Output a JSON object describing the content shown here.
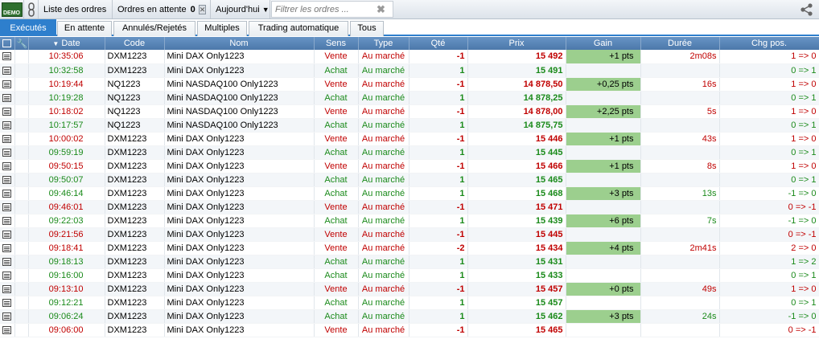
{
  "toolbar": {
    "logo_text": "DEMO",
    "list_label": "Liste des ordres",
    "pending_label": "Ordres en attente",
    "pending_count": "0",
    "today_label": "Aujourd'hui",
    "filter_placeholder": "Filtrer les ordres ..."
  },
  "tabs": [
    {
      "label": "Exécutés"
    },
    {
      "label": "En attente"
    },
    {
      "label": "Annulés/Rejetés"
    },
    {
      "label": "Multiples"
    },
    {
      "label": "Trading automatique"
    },
    {
      "label": "Tous"
    }
  ],
  "columns": [
    "Date",
    "Code",
    "Nom",
    "Sens",
    "Type",
    "Qté",
    "Prix",
    "Gain",
    "Durée",
    "Chg pos."
  ],
  "colors": {
    "sell": "#c00000",
    "buy": "#1a8a1a",
    "gain_fill": "#9ccf8e",
    "accent": "#2e7fcd"
  },
  "rows": [
    {
      "date": "10:35:06",
      "code": "DXM1223",
      "name": "Mini DAX Only1223",
      "side": "Vente",
      "type": "Au marché",
      "qty": "-1",
      "price": "15 492",
      "gain": "+1 pts",
      "duration": "2m08s",
      "chg": "1 => 0"
    },
    {
      "date": "10:32:58",
      "code": "DXM1223",
      "name": "Mini DAX Only1223",
      "side": "Achat",
      "type": "Au marché",
      "qty": "1",
      "price": "15 491",
      "gain": "",
      "duration": "",
      "chg": "0 => 1"
    },
    {
      "date": "10:19:44",
      "code": "NQ1223",
      "name": "Mini NASDAQ100 Only1223",
      "side": "Vente",
      "type": "Au marché",
      "qty": "-1",
      "price": "14 878,50",
      "gain": "+0,25 pts",
      "duration": "16s",
      "chg": "1 => 0"
    },
    {
      "date": "10:19:28",
      "code": "NQ1223",
      "name": "Mini NASDAQ100 Only1223",
      "side": "Achat",
      "type": "Au marché",
      "qty": "1",
      "price": "14 878,25",
      "gain": "",
      "duration": "",
      "chg": "0 => 1"
    },
    {
      "date": "10:18:02",
      "code": "NQ1223",
      "name": "Mini NASDAQ100 Only1223",
      "side": "Vente",
      "type": "Au marché",
      "qty": "-1",
      "price": "14 878,00",
      "gain": "+2,25 pts",
      "duration": "5s",
      "chg": "1 => 0"
    },
    {
      "date": "10:17:57",
      "code": "NQ1223",
      "name": "Mini NASDAQ100 Only1223",
      "side": "Achat",
      "type": "Au marché",
      "qty": "1",
      "price": "14 875,75",
      "gain": "",
      "duration": "",
      "chg": "0 => 1"
    },
    {
      "date": "10:00:02",
      "code": "DXM1223",
      "name": "Mini DAX Only1223",
      "side": "Vente",
      "type": "Au marché",
      "qty": "-1",
      "price": "15 446",
      "gain": "+1 pts",
      "duration": "43s",
      "chg": "1 => 0"
    },
    {
      "date": "09:59:19",
      "code": "DXM1223",
      "name": "Mini DAX Only1223",
      "side": "Achat",
      "type": "Au marché",
      "qty": "1",
      "price": "15 445",
      "gain": "",
      "duration": "",
      "chg": "0 => 1"
    },
    {
      "date": "09:50:15",
      "code": "DXM1223",
      "name": "Mini DAX Only1223",
      "side": "Vente",
      "type": "Au marché",
      "qty": "-1",
      "price": "15 466",
      "gain": "+1 pts",
      "duration": "8s",
      "chg": "1 => 0"
    },
    {
      "date": "09:50:07",
      "code": "DXM1223",
      "name": "Mini DAX Only1223",
      "side": "Achat",
      "type": "Au marché",
      "qty": "1",
      "price": "15 465",
      "gain": "",
      "duration": "",
      "chg": "0 => 1"
    },
    {
      "date": "09:46:14",
      "code": "DXM1223",
      "name": "Mini DAX Only1223",
      "side": "Achat",
      "type": "Au marché",
      "qty": "1",
      "price": "15 468",
      "gain": "+3 pts",
      "duration": "13s",
      "chg": "-1 => 0"
    },
    {
      "date": "09:46:01",
      "code": "DXM1223",
      "name": "Mini DAX Only1223",
      "side": "Vente",
      "type": "Au marché",
      "qty": "-1",
      "price": "15 471",
      "gain": "",
      "duration": "",
      "chg": "0 => -1"
    },
    {
      "date": "09:22:03",
      "code": "DXM1223",
      "name": "Mini DAX Only1223",
      "side": "Achat",
      "type": "Au marché",
      "qty": "1",
      "price": "15 439",
      "gain": "+6 pts",
      "duration": "7s",
      "chg": "-1 => 0"
    },
    {
      "date": "09:21:56",
      "code": "DXM1223",
      "name": "Mini DAX Only1223",
      "side": "Vente",
      "type": "Au marché",
      "qty": "-1",
      "price": "15 445",
      "gain": "",
      "duration": "",
      "chg": "0 => -1"
    },
    {
      "date": "09:18:41",
      "code": "DXM1223",
      "name": "Mini DAX Only1223",
      "side": "Vente",
      "type": "Au marché",
      "qty": "-2",
      "price": "15 434",
      "gain": "+4 pts",
      "duration": "2m41s",
      "chg": "2 => 0"
    },
    {
      "date": "09:18:13",
      "code": "DXM1223",
      "name": "Mini DAX Only1223",
      "side": "Achat",
      "type": "Au marché",
      "qty": "1",
      "price": "15 431",
      "gain": "",
      "duration": "",
      "chg": "1 => 2"
    },
    {
      "date": "09:16:00",
      "code": "DXM1223",
      "name": "Mini DAX Only1223",
      "side": "Achat",
      "type": "Au marché",
      "qty": "1",
      "price": "15 433",
      "gain": "",
      "duration": "",
      "chg": "0 => 1"
    },
    {
      "date": "09:13:10",
      "code": "DXM1223",
      "name": "Mini DAX Only1223",
      "side": "Vente",
      "type": "Au marché",
      "qty": "-1",
      "price": "15 457",
      "gain": "+0 pts",
      "duration": "49s",
      "chg": "1 => 0"
    },
    {
      "date": "09:12:21",
      "code": "DXM1223",
      "name": "Mini DAX Only1223",
      "side": "Achat",
      "type": "Au marché",
      "qty": "1",
      "price": "15 457",
      "gain": "",
      "duration": "",
      "chg": "0 => 1"
    },
    {
      "date": "09:06:24",
      "code": "DXM1223",
      "name": "Mini DAX Only1223",
      "side": "Achat",
      "type": "Au marché",
      "qty": "1",
      "price": "15 462",
      "gain": "+3 pts",
      "duration": "24s",
      "chg": "-1 => 0"
    },
    {
      "date": "09:06:00",
      "code": "DXM1223",
      "name": "Mini DAX Only1223",
      "side": "Vente",
      "type": "Au marché",
      "qty": "-1",
      "price": "15 465",
      "gain": "",
      "duration": "",
      "chg": "0 => -1"
    }
  ]
}
